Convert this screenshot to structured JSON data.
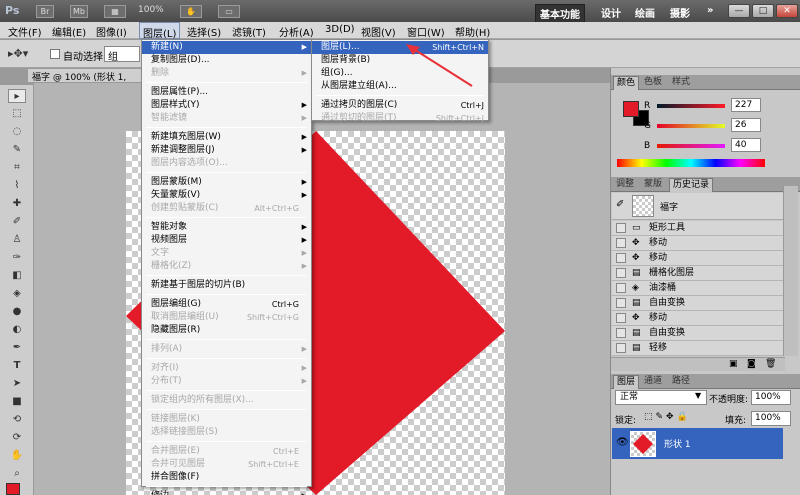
{
  "app": {
    "logo": "Ps",
    "toolbar_buttons": [
      "Br",
      "Mb"
    ],
    "zoom": "100%",
    "workspaces": [
      "基本功能",
      "设计",
      "绘画",
      "摄影"
    ],
    "more": "»",
    "window_buttons": [
      "—",
      "□",
      "✕"
    ]
  },
  "menubar": {
    "items": [
      "文件(F)",
      "编辑(E)",
      "图像(I)",
      "图层(L)",
      "选择(S)",
      "滤镜(T)",
      "分析(A)",
      "3D(D)",
      "视图(V)",
      "窗口(W)",
      "帮助(H)"
    ]
  },
  "options": {
    "auto_select_label": "自动选择:",
    "auto_select_value": "组"
  },
  "document": {
    "tab_title": "福字 @ 100% (形状 1,"
  },
  "layer_menu": {
    "items": [
      {
        "label": "新建(N)",
        "shortcut": "",
        "arrow": true,
        "state": "hl"
      },
      {
        "label": "复制图层(D)...",
        "shortcut": "",
        "arrow": false,
        "state": ""
      },
      {
        "label": "删除",
        "shortcut": "",
        "arrow": true,
        "state": "dis"
      },
      {
        "sep": true
      },
      {
        "label": "图层属性(P)...",
        "shortcut": "",
        "arrow": false,
        "state": ""
      },
      {
        "label": "图层样式(Y)",
        "shortcut": "",
        "arrow": true,
        "state": ""
      },
      {
        "label": "智能滤镜",
        "shortcut": "",
        "arrow": true,
        "state": "dis"
      },
      {
        "sep": true
      },
      {
        "label": "新建填充图层(W)",
        "shortcut": "",
        "arrow": true,
        "state": ""
      },
      {
        "label": "新建调整图层(J)",
        "shortcut": "",
        "arrow": true,
        "state": ""
      },
      {
        "label": "图层内容选项(O)...",
        "shortcut": "",
        "arrow": false,
        "state": "dis"
      },
      {
        "sep": true
      },
      {
        "label": "图层蒙版(M)",
        "shortcut": "",
        "arrow": true,
        "state": ""
      },
      {
        "label": "矢量蒙版(V)",
        "shortcut": "",
        "arrow": true,
        "state": ""
      },
      {
        "label": "创建剪贴蒙版(C)",
        "shortcut": "Alt+Ctrl+G",
        "arrow": false,
        "state": "dis"
      },
      {
        "sep": true
      },
      {
        "label": "智能对象",
        "shortcut": "",
        "arrow": true,
        "state": ""
      },
      {
        "label": "视频图层",
        "shortcut": "",
        "arrow": true,
        "state": ""
      },
      {
        "label": "文字",
        "shortcut": "",
        "arrow": true,
        "state": "dis"
      },
      {
        "label": "栅格化(Z)",
        "shortcut": "",
        "arrow": true,
        "state": "dis"
      },
      {
        "sep": true
      },
      {
        "label": "新建基于图层的切片(B)",
        "shortcut": "",
        "arrow": false,
        "state": ""
      },
      {
        "sep": true
      },
      {
        "label": "图层编组(G)",
        "shortcut": "Ctrl+G",
        "arrow": false,
        "state": ""
      },
      {
        "label": "取消图层编组(U)",
        "shortcut": "Shift+Ctrl+G",
        "arrow": false,
        "state": "dis"
      },
      {
        "label": "隐藏图层(R)",
        "shortcut": "",
        "arrow": false,
        "state": ""
      },
      {
        "sep": true
      },
      {
        "label": "排列(A)",
        "shortcut": "",
        "arrow": true,
        "state": "dis"
      },
      {
        "sep": true
      },
      {
        "label": "对齐(I)",
        "shortcut": "",
        "arrow": true,
        "state": "dis"
      },
      {
        "label": "分布(T)",
        "shortcut": "",
        "arrow": true,
        "state": "dis"
      },
      {
        "sep": true
      },
      {
        "label": "锁定组内的所有图层(X)...",
        "shortcut": "",
        "arrow": false,
        "state": "dis"
      },
      {
        "sep": true
      },
      {
        "label": "链接图层(K)",
        "shortcut": "",
        "arrow": false,
        "state": "dis"
      },
      {
        "label": "选择链接图层(S)",
        "shortcut": "",
        "arrow": false,
        "state": "dis"
      },
      {
        "sep": true
      },
      {
        "label": "合并图层(E)",
        "shortcut": "Ctrl+E",
        "arrow": false,
        "state": "dis"
      },
      {
        "label": "合并可见图层",
        "shortcut": "Shift+Ctrl+E",
        "arrow": false,
        "state": "dis"
      },
      {
        "label": "拼合图像(F)",
        "shortcut": "",
        "arrow": false,
        "state": ""
      },
      {
        "sep": true
      },
      {
        "label": "修边",
        "shortcut": "",
        "arrow": true,
        "state": ""
      }
    ]
  },
  "new_submenu": {
    "items": [
      {
        "label": "图层(L)...",
        "shortcut": "Shift+Ctrl+N",
        "state": "hl"
      },
      {
        "label": "图层背景(B)",
        "shortcut": "",
        "state": ""
      },
      {
        "label": "组(G)...",
        "shortcut": "",
        "state": ""
      },
      {
        "label": "从图层建立组(A)...",
        "shortcut": "",
        "state": ""
      },
      {
        "sep": true
      },
      {
        "label": "通过拷贝的图层(C)",
        "shortcut": "Ctrl+J",
        "state": ""
      },
      {
        "label": "通过剪切的图层(T)",
        "shortcut": "Shift+Ctrl+J",
        "state": "dis"
      }
    ]
  },
  "color_panel": {
    "tabs": [
      "颜色",
      "色板",
      "样式"
    ],
    "r_label": "R",
    "g_label": "G",
    "b_label": "B",
    "r": "227",
    "g": "26",
    "b": "40",
    "fg": "#e31a28",
    "bg": "#000000"
  },
  "history_panel": {
    "tabs": [
      "调整",
      "蒙版",
      "历史记录"
    ],
    "snapshot": "福字",
    "items": [
      {
        "label": "矩形工具",
        "icon": "▭"
      },
      {
        "label": "移动",
        "icon": "✥"
      },
      {
        "label": "移动",
        "icon": "✥"
      },
      {
        "label": "栅格化图层",
        "icon": "▤"
      },
      {
        "label": "油漆桶",
        "icon": "◈"
      },
      {
        "label": "自由变换",
        "icon": "▤"
      },
      {
        "label": "移动",
        "icon": "✥"
      },
      {
        "label": "自由变换",
        "icon": "▤"
      },
      {
        "label": "轻移",
        "icon": "▤"
      }
    ]
  },
  "layers_panel": {
    "tabs": [
      "图层",
      "通道",
      "路径"
    ],
    "blend_mode": "正常",
    "opacity_label": "不透明度:",
    "opacity": "100%",
    "lock_label": "锁定:",
    "fill_label": "填充:",
    "fill": "100%",
    "layer_name": "形状 1"
  },
  "colors": {
    "accent": "#3464bd",
    "shape_red": "#e31a28"
  }
}
